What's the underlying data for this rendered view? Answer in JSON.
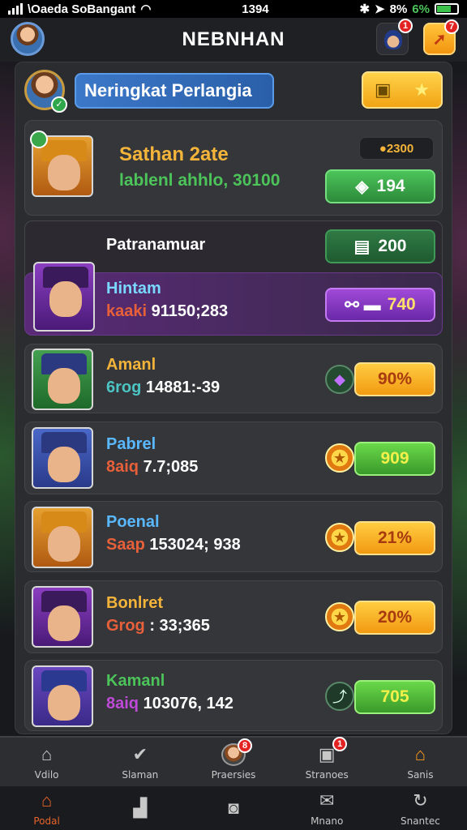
{
  "status_bar": {
    "carrier": "\\Oaeda SoBangant",
    "time": "1394",
    "battery_percent": "8%",
    "extra": "6%"
  },
  "header": {
    "title": "NEBNHAN",
    "char_badge": "1",
    "gift_badge": "7"
  },
  "section": {
    "title": "Neringkat Perlangia"
  },
  "featured": {
    "name": "Sathan 2ate",
    "subtitle": "lablenl ahhlo, 30100",
    "coins": "2300",
    "score": "194"
  },
  "ranking_header": {
    "label": "Patranamuar",
    "score": "200"
  },
  "players": [
    {
      "name": "Hintam",
      "tag": "kaaki",
      "value": "91150;283",
      "score": "740"
    },
    {
      "name": "Amanl",
      "tag": "6rog",
      "value": "14881:-39",
      "score": "90%"
    },
    {
      "name": "Pabrel",
      "tag": "8aiq",
      "value": "7.7;085",
      "score": "909"
    },
    {
      "name": "Poenal",
      "tag": "Saap",
      "value": "153024; 938",
      "score": "21%"
    },
    {
      "name": "Bonlret",
      "tag": "Grog",
      "value": ": 33;365",
      "score": "20%"
    },
    {
      "name": "Kamanl",
      "tag": "8aiq",
      "value": "103076, 142",
      "score": "705"
    }
  ],
  "nav_top": [
    {
      "label": "Vdilo",
      "icon": "home-icon"
    },
    {
      "label": "Slaman",
      "icon": "check-card-icon"
    },
    {
      "label": "Praersies",
      "icon": "avatar-icon",
      "badge": "8"
    },
    {
      "label": "Stranoes",
      "icon": "board-icon",
      "badge": "1"
    },
    {
      "label": "Sanis",
      "icon": "house-icon"
    }
  ],
  "nav_bottom": [
    {
      "label": "Podal",
      "icon": "home-icon"
    },
    {
      "label": "",
      "icon": "chart-icon"
    },
    {
      "label": "",
      "icon": "square-icon"
    },
    {
      "label": "Mnano",
      "icon": "mail-icon"
    },
    {
      "label": "Snantec",
      "icon": "refresh-icon"
    }
  ],
  "colors": {
    "accent_gold": "#f4b43a",
    "accent_green": "#4cc45a",
    "accent_purple": "#a04ad8",
    "header_blue": "#3c78c8"
  }
}
